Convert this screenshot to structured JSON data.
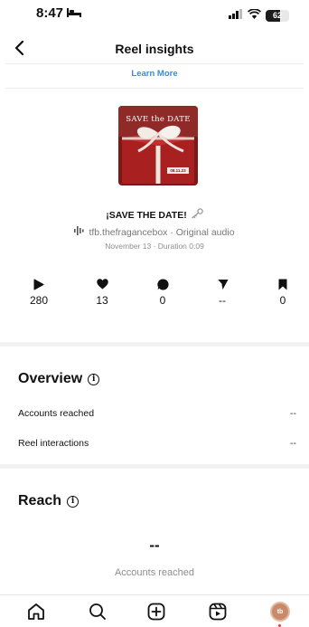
{
  "status": {
    "time": "8:47",
    "battery": "62",
    "battery_level_pct": 62
  },
  "header": {
    "title": "Reel insights",
    "learn_more": "Learn More"
  },
  "reel": {
    "thumbnail_text": "SAVE the DATE",
    "thumbnail_tag": "08.11.23",
    "title": "¡SAVE THE DATE!",
    "audio": "tfb.thefragancebox · Original audio",
    "meta": "November 13 · Duration 0:09"
  },
  "stats": [
    {
      "icon": "play-icon",
      "value": "280"
    },
    {
      "icon": "heart-icon",
      "value": "13"
    },
    {
      "icon": "comment-icon",
      "value": "0"
    },
    {
      "icon": "share-icon",
      "value": "--"
    },
    {
      "icon": "bookmark-icon",
      "value": "0"
    }
  ],
  "overview": {
    "title": "Overview",
    "rows": [
      {
        "label": "Accounts reached",
        "value": "--"
      },
      {
        "label": "Reel interactions",
        "value": "--"
      }
    ]
  },
  "reach": {
    "title": "Reach",
    "value": "--",
    "label": "Accounts reached"
  },
  "tabs": [
    "home-icon",
    "search-icon",
    "create-icon",
    "reels-icon",
    "profile-avatar"
  ],
  "colors": {
    "accent_link": "#3a8bd6",
    "thumbnail_red": "#a8201f",
    "notification": "#ff3040"
  }
}
